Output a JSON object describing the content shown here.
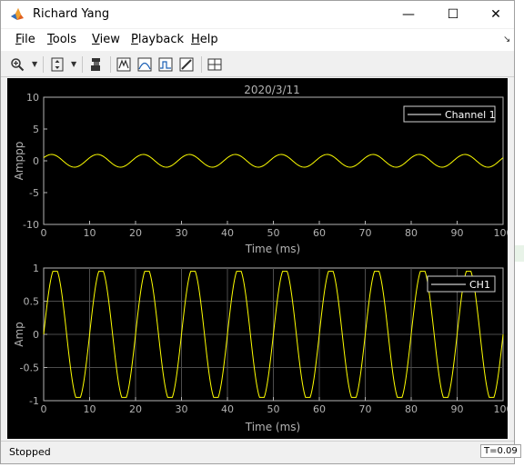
{
  "window": {
    "title": "Richard Yang",
    "minimize_glyph": "—",
    "maximize_glyph": "☐",
    "close_glyph": "✕"
  },
  "menu": [
    {
      "key": "F",
      "rest": "ile"
    },
    {
      "key": "T",
      "rest": "ools"
    },
    {
      "key": "V",
      "rest": "iew"
    },
    {
      "key": "P",
      "rest": "layback"
    },
    {
      "key": "H",
      "rest": "elp"
    }
  ],
  "toolbar_icons": [
    "zoom-in-icon",
    "scale-y-icon",
    "autoscale-icon",
    "trigger-icon",
    "cursor-icon",
    "peak-finder-icon",
    "measurement-icon",
    "layout-icon"
  ],
  "status": {
    "state": "Stopped",
    "time": "T=0.09"
  },
  "colors": {
    "signal": "#ffff00",
    "axes_bg": "#000000",
    "grid": "#4d4d4d",
    "text": "#b3b3b3"
  },
  "chart_data": [
    {
      "type": "line",
      "title": "2020/3/11",
      "xlabel": "Time (ms)",
      "ylabel": "Amppp",
      "xlim": [
        0,
        100
      ],
      "ylim": [
        -10,
        10
      ],
      "xticks": [
        "0",
        "10",
        "20",
        "30",
        "40",
        "50",
        "60",
        "70",
        "80",
        "90",
        "100"
      ],
      "yticks": [
        "10",
        "5",
        "0",
        "-5",
        "-10"
      ],
      "grid": false,
      "legend": "top-right",
      "series": [
        {
          "name": "Channel 1",
          "waveform": "sine",
          "amplitude": 1,
          "period_ms": 10,
          "phase": 0.5
        }
      ]
    },
    {
      "type": "line",
      "title": "",
      "xlabel": "Time (ms)",
      "ylabel": "Amp",
      "xlim": [
        0,
        100
      ],
      "ylim": [
        -1,
        1
      ],
      "xticks": [
        "0",
        "10",
        "20",
        "30",
        "40",
        "50",
        "60",
        "70",
        "80",
        "90",
        "100"
      ],
      "yticks": [
        "1",
        "0.5",
        "0",
        "-0.5",
        "-1"
      ],
      "grid": true,
      "legend": "top-right",
      "series": [
        {
          "name": "CH1",
          "waveform": "sine",
          "amplitude": 1.0,
          "period_ms": 10,
          "phase": 0,
          "clip": 0.95
        }
      ]
    }
  ]
}
